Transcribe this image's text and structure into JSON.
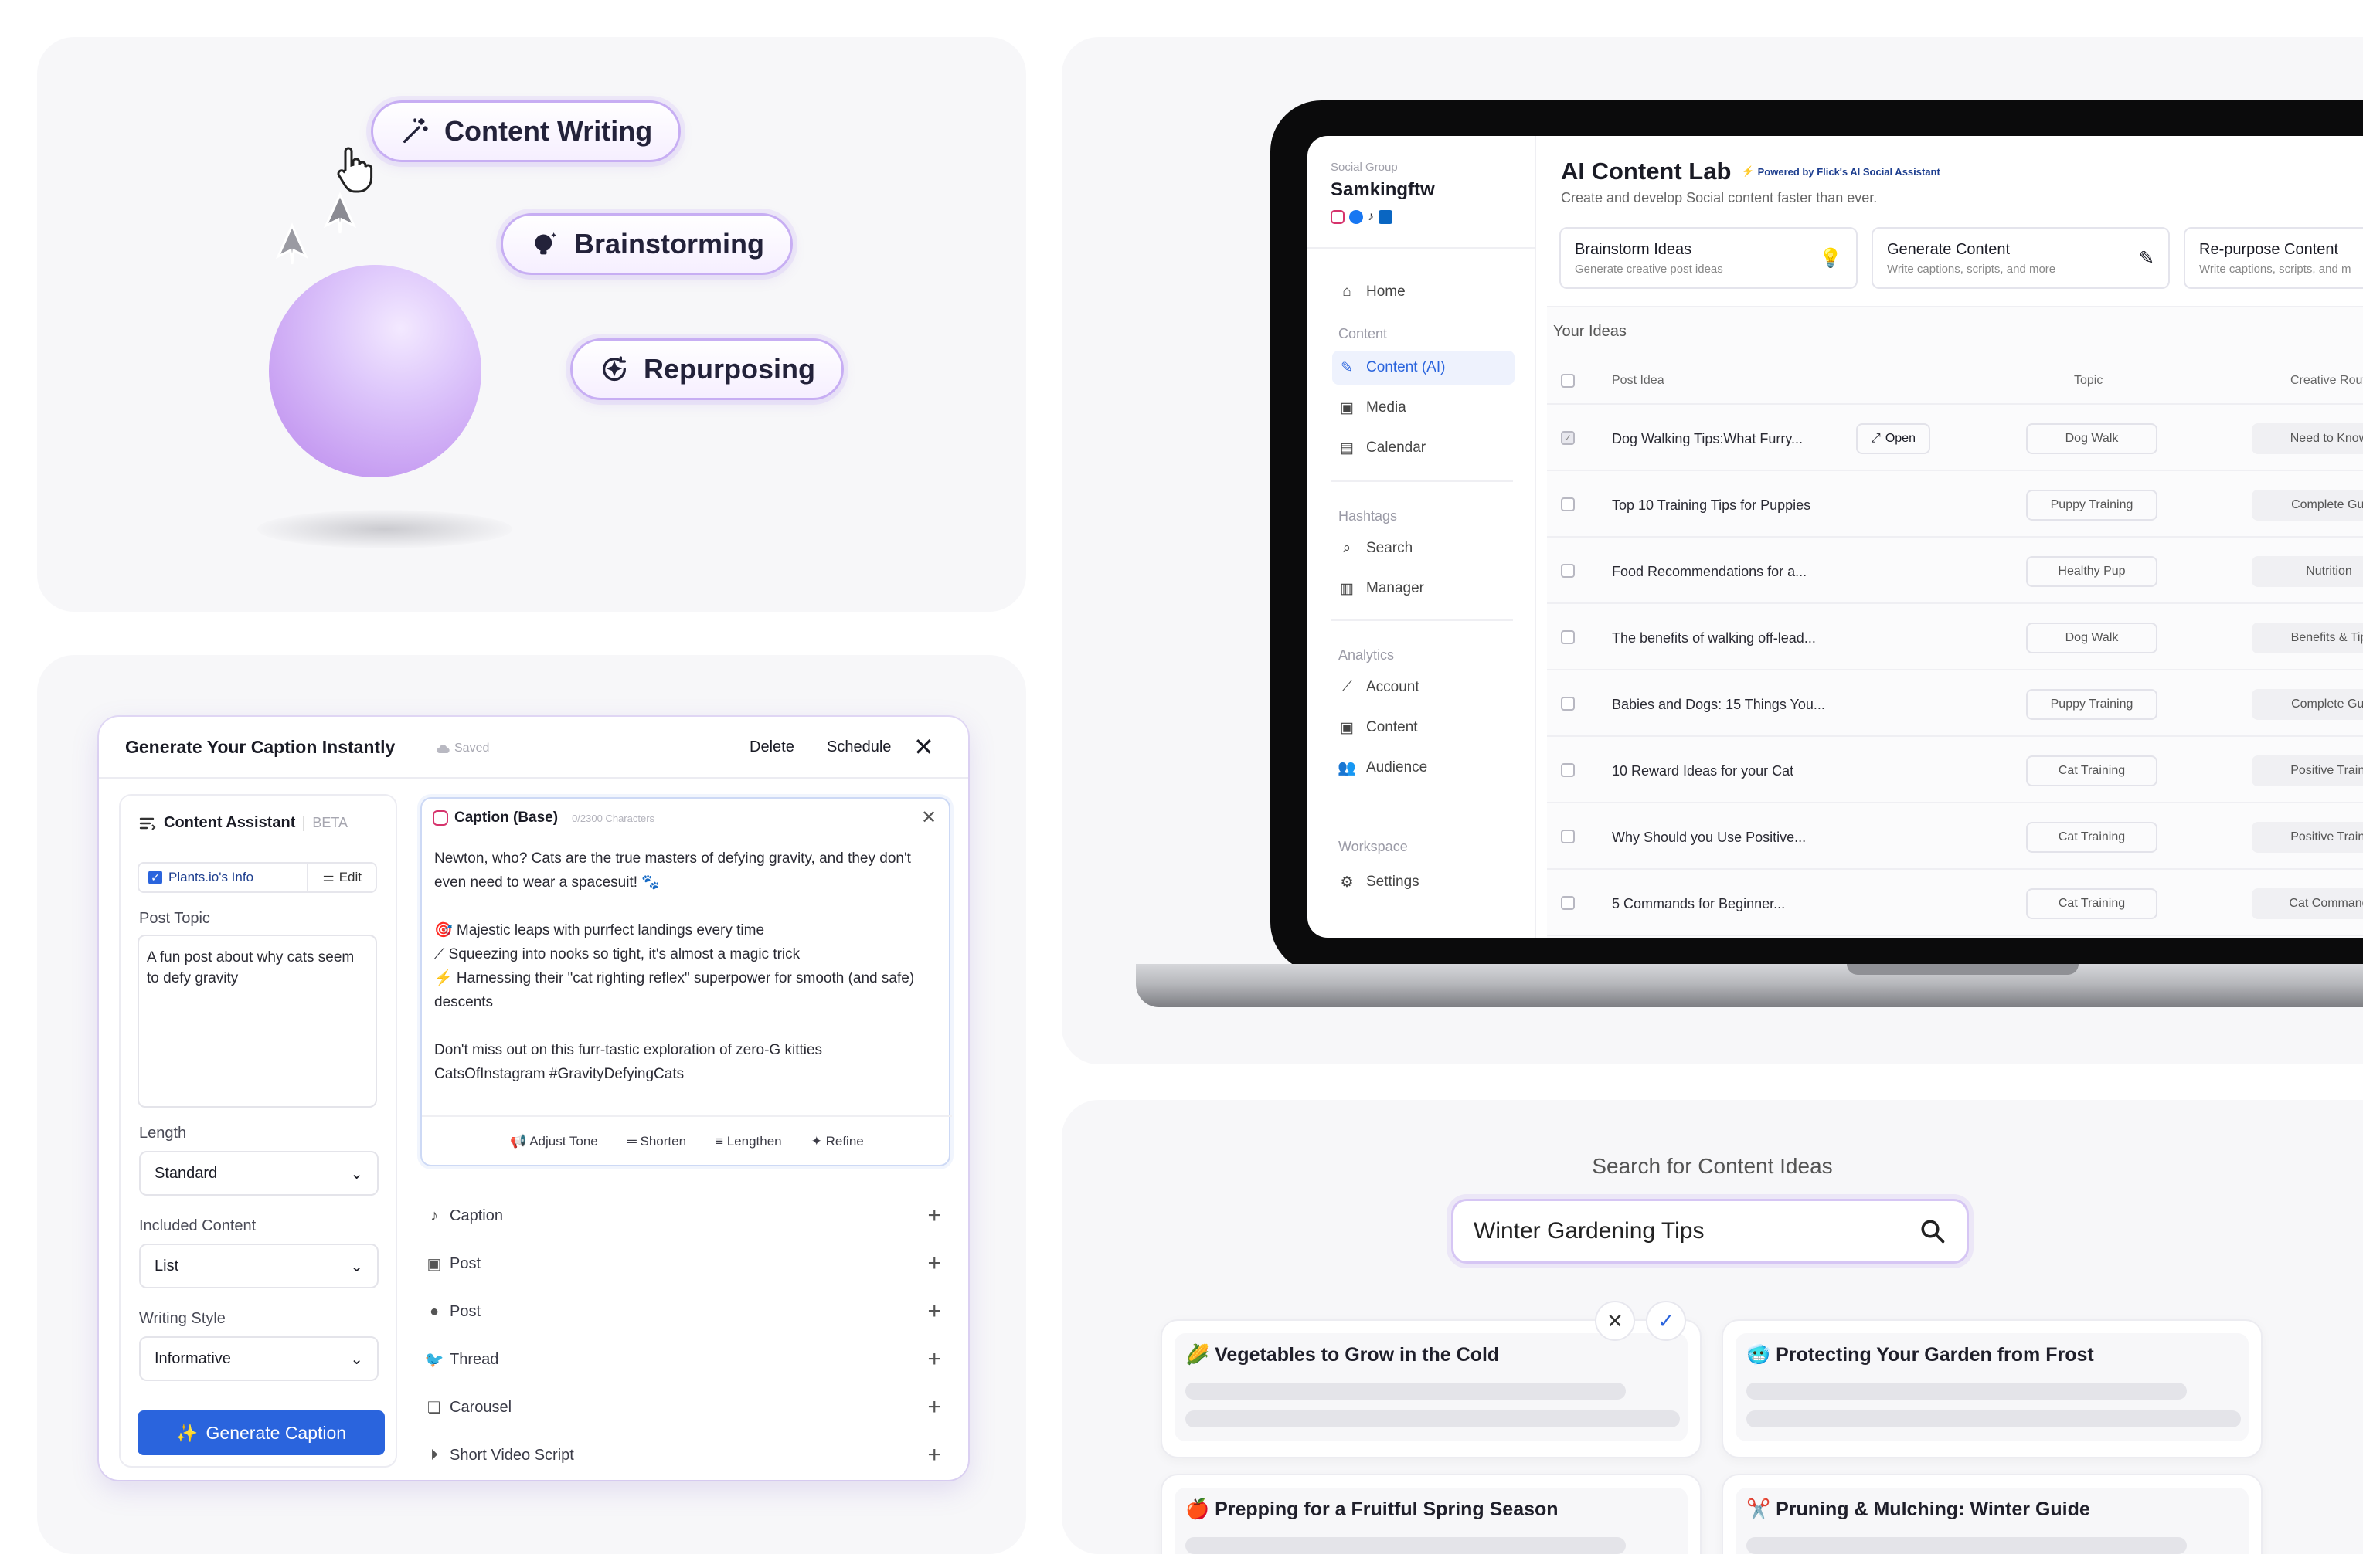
{
  "panel_features": {
    "pills": [
      {
        "label": "Content Writing",
        "icon": "magic-wand-icon"
      },
      {
        "label": "Brainstorming",
        "icon": "lightbulb-icon"
      },
      {
        "label": "Repurposing",
        "icon": "repurpose-icon"
      }
    ]
  },
  "caption_modal": {
    "title": "Generate Your Caption Instantly",
    "saved": "Saved",
    "delete": "Delete",
    "schedule": "Schedule",
    "assistant": {
      "title": "Content Assistant",
      "beta": "BETA",
      "info_label": "Plants.io's Info",
      "edit": "Edit",
      "post_topic_label": "Post Topic",
      "post_topic_value": "A fun post about why cats seem to defy gravity",
      "length_label": "Length",
      "length_value": "Standard",
      "included_label": "Included Content",
      "included_value": "List",
      "style_label": "Writing Style",
      "style_value": "Informative",
      "generate": "Generate Caption"
    },
    "caption": {
      "title": "Caption (Base)",
      "counter": "0/2300 Characters",
      "line1": "Newton, who? Cats are the true masters of defying gravity, and they don't even need to wear a spacesuit! 🐾",
      "line2": "🎯 Majestic leaps with purrfect landings every time",
      "line3": "⟋ Squeezing into nooks so tight, it's almost a magic trick",
      "line4": "⚡ Harnessing their \"cat righting reflex\" superpower for smooth (and safe) descents",
      "line5": "Don't miss out on this furr-tastic exploration of zero-G kitties CatsOfInstagram #GravityDefyingCats",
      "actions": [
        "Adjust Tone",
        "Shorten",
        "Lengthen",
        "Refine"
      ]
    },
    "accordion": [
      "Caption",
      "Post",
      "Post",
      "Thread",
      "Carousel",
      "Short Video Script"
    ]
  },
  "content_lab": {
    "group_label": "Social Group",
    "group_name": "Samkingftw",
    "nav": {
      "home": "Home",
      "content_section": "Content",
      "content_ai": "Content (AI)",
      "media": "Media",
      "calendar": "Calendar",
      "hashtags_section": "Hashtags",
      "search": "Search",
      "manager": "Manager",
      "analytics_section": "Analytics",
      "account": "Account",
      "content": "Content",
      "audience": "Audience",
      "workspace_section": "Workspace",
      "settings": "Settings"
    },
    "title": "AI Content Lab",
    "powered": "Powered by Flick's AI Social Assistant",
    "subtitle": "Create and develop Social content faster than ever.",
    "cards": [
      {
        "title": "Brainstorm Ideas",
        "desc": "Generate creative post ideas"
      },
      {
        "title": "Generate Content",
        "desc": "Write captions, scripts, and more"
      },
      {
        "title": "Re-purpose Content",
        "desc": "Write captions, scripts, and m"
      }
    ],
    "ideas_title": "Your Ideas",
    "columns": [
      "Post Idea",
      "Topic",
      "Creative Rout"
    ],
    "open_label": "Open",
    "rows": [
      {
        "idea": "Dog Walking Tips:What Furry...",
        "topic": "Dog Walk",
        "route": "Need to Know"
      },
      {
        "idea": "Top 10 Training Tips for Puppies",
        "topic": "Puppy Training",
        "route": "Complete Gui"
      },
      {
        "idea": "Food Recommendations for a...",
        "topic": "Healthy Pup",
        "route": "Nutrition"
      },
      {
        "idea": "The benefits of walking off-lead...",
        "topic": "Dog Walk",
        "route": "Benefits & Tip"
      },
      {
        "idea": "Babies and Dogs: 15 Things You...",
        "topic": "Puppy Training",
        "route": "Complete Gui"
      },
      {
        "idea": "10 Reward Ideas for your Cat",
        "topic": "Cat Training",
        "route": "Positive Traini"
      },
      {
        "idea": "Why Should you Use Positive...",
        "topic": "Cat Training",
        "route": "Positive Traini"
      },
      {
        "idea": "5 Commands for Beginner...",
        "topic": "Cat Training",
        "route": "Cat Command"
      }
    ]
  },
  "search_panel": {
    "heading": "Search for Content Ideas",
    "query": "Winter Gardening Tips",
    "results": [
      {
        "emoji": "🌽",
        "title": "Vegetables to Grow in the Cold"
      },
      {
        "emoji": "🥶",
        "title": "Protecting Your Garden from Frost"
      },
      {
        "emoji": "🍎",
        "title": "Prepping for a Fruitful Spring Season"
      },
      {
        "emoji": "✂️",
        "title": "Pruning & Mulching: Winter Guide"
      }
    ]
  },
  "colors": {
    "accent_blue": "#2a64dd",
    "pill_border": "#c7aef3",
    "sphere_purple": "#c79ef2",
    "panel_bg": "#f7f7f9"
  }
}
